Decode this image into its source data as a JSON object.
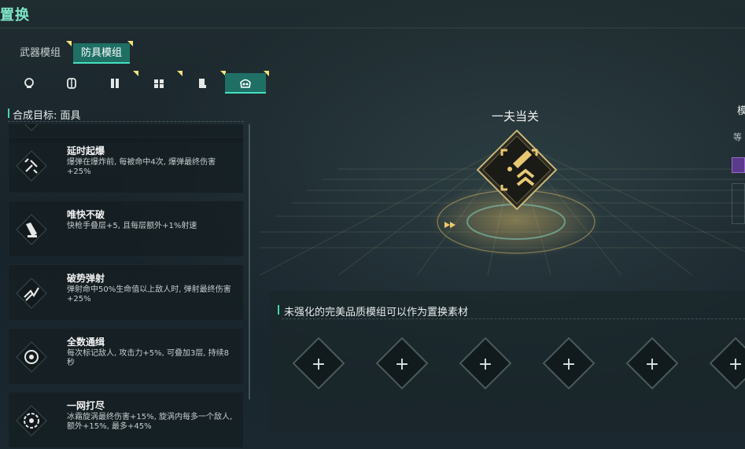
{
  "screen": {
    "title": "置换"
  },
  "tabs": [
    {
      "label": "武器模组",
      "active": false
    },
    {
      "label": "防具模组",
      "active": true
    }
  ],
  "slots": [
    {
      "icon": "mask-icon",
      "active": false
    },
    {
      "icon": "armor-icon",
      "active": false
    },
    {
      "icon": "gloves-icon",
      "active": false
    },
    {
      "icon": "pants-icon",
      "active": false
    },
    {
      "icon": "boots-icon",
      "active": false
    },
    {
      "icon": "face-mask-icon",
      "active": true
    }
  ],
  "left_panel": {
    "title": "合成目标: 面具"
  },
  "perks": [
    {
      "name": "延时起爆",
      "desc": "爆弹在爆炸前, 每被命中4次, 爆弹最终伤害+25%",
      "icon": "detonation-icon"
    },
    {
      "name": "唯快不破",
      "desc": "快枪手叠层+5, 且每层额外+1%射速",
      "icon": "fast-gun-icon"
    },
    {
      "name": "破势弹射",
      "desc": "弹射命中50%生命值以上敌人时, 弹射最终伤害+25%",
      "icon": "bounce-icon"
    },
    {
      "name": "全数通缉",
      "desc": "每次标记敌人, 攻击力+5%, 可叠加3层, 持续8秒",
      "icon": "wanted-icon"
    },
    {
      "name": "一网打尽",
      "desc": "冰霜旋涡最终伤害+15%, 旋涡内每多一个敌人, 额外+15%, 最多+45%",
      "icon": "frost-vortex-icon"
    }
  ],
  "target": {
    "name": "一夫当关"
  },
  "materials": {
    "title": "未强化的完美品质模组可以作为置换素材",
    "slot_label": "+"
  },
  "side": {
    "title": "模",
    "sub": "等"
  },
  "colors": {
    "accent": "#46d3b3",
    "tab_active": "#1f6f65",
    "gold": "#e8c872",
    "new_marker": "#f5e27a"
  }
}
